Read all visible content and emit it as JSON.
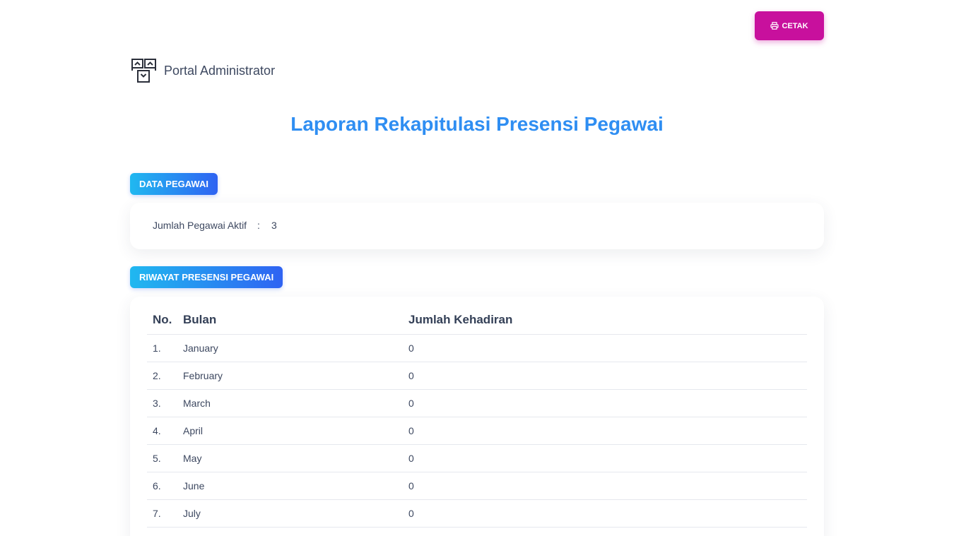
{
  "actions": {
    "print_label": "CETAK",
    "print_icon": "printer-icon"
  },
  "brand": {
    "logo_icon": "sitemap-logo-icon",
    "name": "Portal Administrator"
  },
  "title": "Laporan Rekapitulasi Presensi Pegawai",
  "colors": {
    "accent": "#2f8ef2",
    "print_button": "#c8109d",
    "badge_gradient_start": "#20b8f0",
    "badge_gradient_end": "#2f63f2"
  },
  "data_pegawai": {
    "section_label": "DATA PEGAWAI",
    "active_label": "Jumlah Pegawai Aktif",
    "separator": ":",
    "active_value": "3"
  },
  "riwayat": {
    "section_label": "RIWAYAT PRESENSI PEGAWAI",
    "columns": [
      "No.",
      "Bulan",
      "Jumlah Kehadiran"
    ],
    "rows": [
      {
        "no": "1.",
        "bulan": "January",
        "jumlah": "0"
      },
      {
        "no": "2.",
        "bulan": "February",
        "jumlah": "0"
      },
      {
        "no": "3.",
        "bulan": "March",
        "jumlah": "0"
      },
      {
        "no": "4.",
        "bulan": "April",
        "jumlah": "0"
      },
      {
        "no": "5.",
        "bulan": "May",
        "jumlah": "0"
      },
      {
        "no": "6.",
        "bulan": "June",
        "jumlah": "0"
      },
      {
        "no": "7.",
        "bulan": "July",
        "jumlah": "0"
      }
    ]
  }
}
